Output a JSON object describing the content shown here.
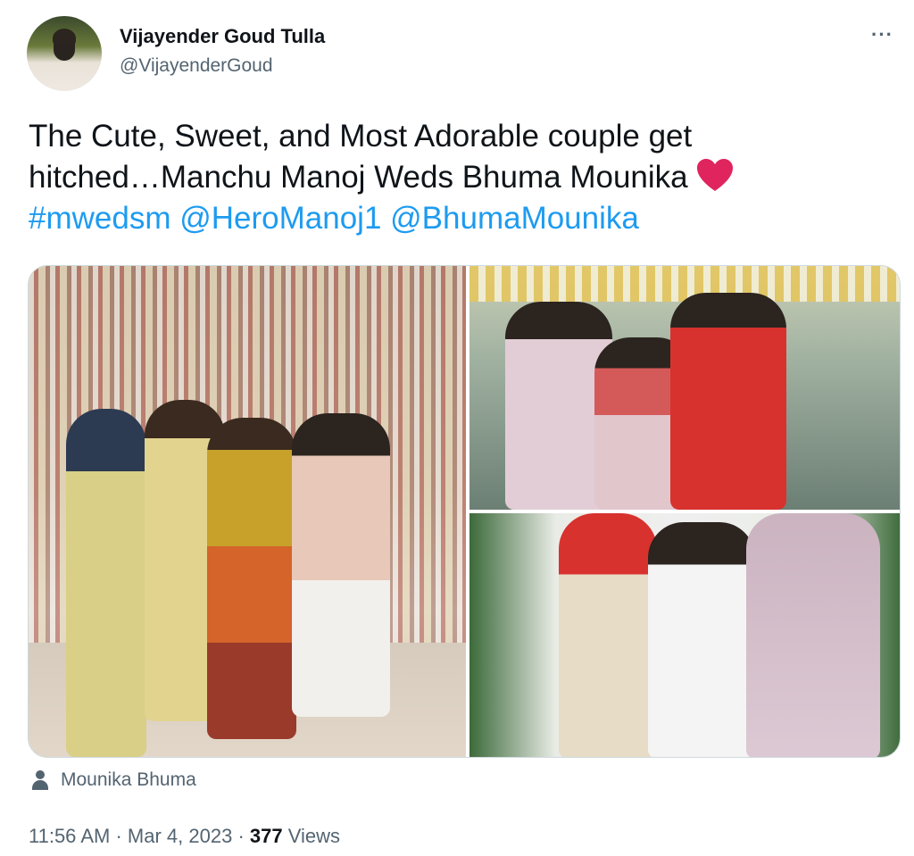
{
  "author": {
    "name": "Vijayender Goud Tulla",
    "handle": "@VijayenderGoud"
  },
  "more_label": "···",
  "tweet": {
    "text_line1": "The Cute, Sweet, and Most Adorable couple get",
    "text_line2": "hitched…Manchu Manoj Weds Bhuma Mounika",
    "hashtag": "#mwedsm",
    "mention1": "@HeroManoj1",
    "mention2": "@BhumaMounika",
    "emoji": "heart"
  },
  "media": {
    "count": 3,
    "tagged_user": "Mounika Bhuma"
  },
  "meta": {
    "time": "11:56 AM",
    "date": "Mar 4, 2023",
    "separator": "·",
    "views_count": "377",
    "views_label": "Views"
  },
  "colors": {
    "link": "#1d9bf0",
    "secondary_text": "#536471",
    "primary_text": "#0f1419",
    "heart": "#e0245e"
  }
}
